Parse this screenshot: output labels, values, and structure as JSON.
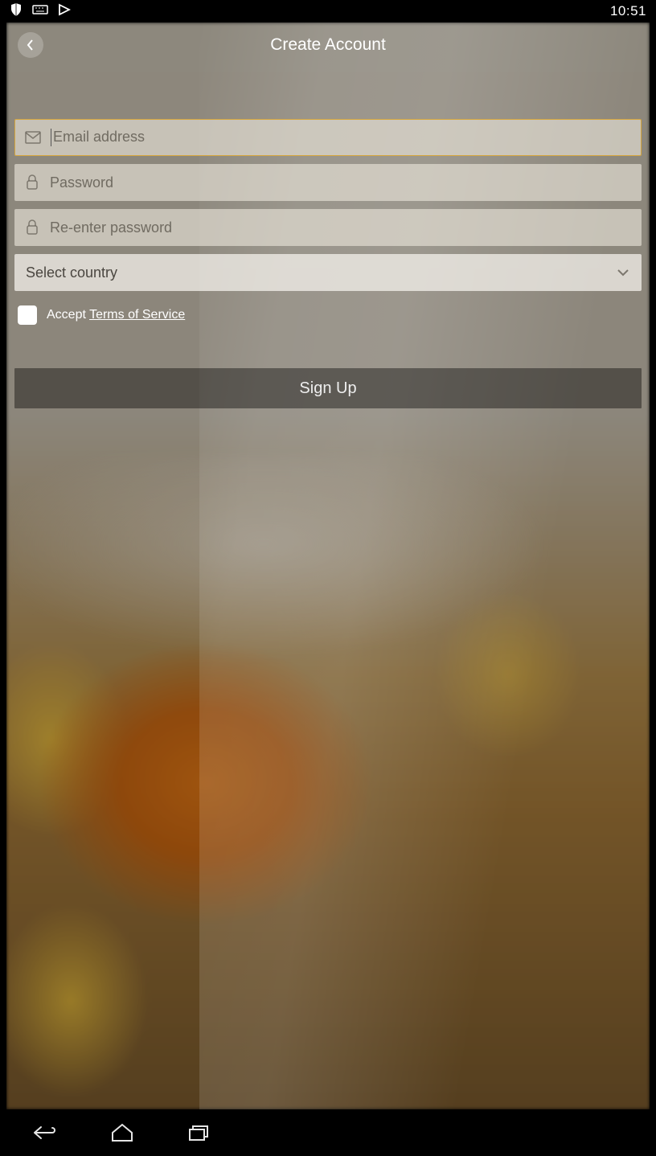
{
  "statusbar": {
    "time": "10:51"
  },
  "header": {
    "title": "Create Account"
  },
  "form": {
    "email_placeholder": "Email address",
    "password_placeholder": "Password",
    "reenter_placeholder": "Re-enter password",
    "country_label": "Select country"
  },
  "terms": {
    "accept_label": "Accept",
    "link_label": "Terms of Service"
  },
  "actions": {
    "signup_label": "Sign Up"
  }
}
